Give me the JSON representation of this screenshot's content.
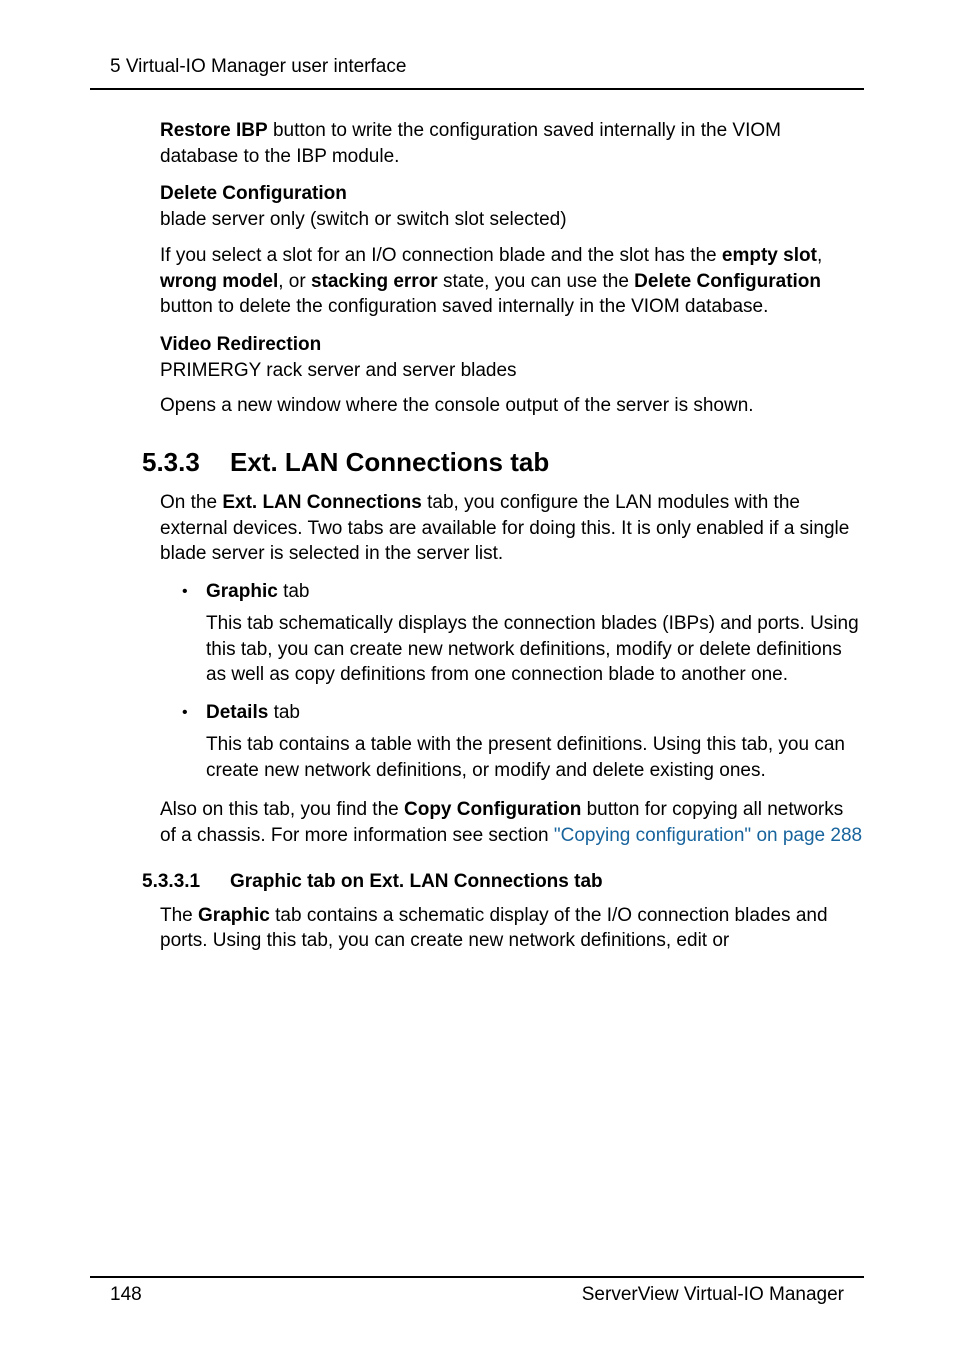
{
  "header": {
    "running": "5 Virtual-IO Manager user interface"
  },
  "body": {
    "intro_para_html": "<b>Restore IBP</b> button to write the configuration saved internally in the VIOM database to the IBP module.",
    "terms": [
      {
        "label": "Delete Configuration",
        "line1": "blade server only (switch or switch slot selected)",
        "para_html": "If you select a slot for an I/O connection blade and the slot has the <b>empty slot</b>, <b>wrong model</b>, or <b>stacking error</b> state, you can use the <b>Delete Configuration</b> button to delete the configuration saved internally in the VIOM database."
      },
      {
        "label": "Video Redirection",
        "line1": "PRIMERGY rack server and server blades",
        "para_html": "Opens a new window where the console output of the server is shown."
      }
    ],
    "section": {
      "num": "5.3.3",
      "title": "Ext. LAN Connections tab",
      "intro_html": "On the <b>Ext. LAN Connections</b> tab, you configure the LAN modules with the external devices. Two tabs are available for doing this. It is only enabled if a single blade server is selected in the server list.",
      "bullets": [
        {
          "label_html": "<b>Graphic</b> tab",
          "body": "This tab schematically displays the connection blades (IBPs) and ports. Using this tab, you can create new network definitions, modify or delete definitions as well as copy definitions from one connection blade to another one."
        },
        {
          "label_html": "<b>Details</b> tab",
          "body": "This tab contains a table with the present definitions. Using this tab, you can create new network definitions, or modify and delete existing ones."
        }
      ],
      "after_bullets_html": "Also on this tab, you find the <b>Copy Configuration</b> button for copying all networks of a chassis. For more information see section <span class=\"link\">\"Copying configuration\" on page 288</span>",
      "sub": {
        "num": "5.3.3.1",
        "title": "Graphic tab on Ext. LAN Connections tab",
        "para_html": "The <b>Graphic</b> tab contains a schematic display of the I/O connection blades and ports. Using this tab, you can create new network definitions, edit or"
      }
    }
  },
  "footer": {
    "page": "148",
    "product": "ServerView Virtual-IO Manager"
  }
}
